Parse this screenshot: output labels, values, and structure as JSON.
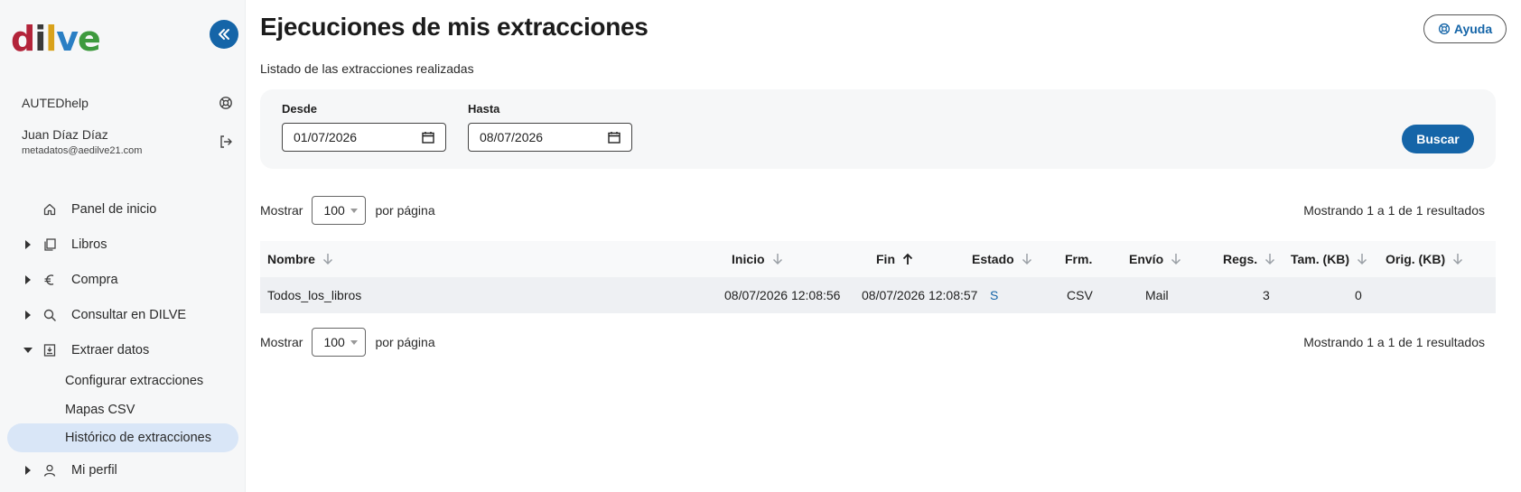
{
  "logo": {
    "letters": [
      "d",
      "i",
      "l",
      "v",
      "e"
    ]
  },
  "sidebar": {
    "org": "AUTEDhelp",
    "user_name": "Juan Díaz Díaz",
    "user_email": "metadatos@aedilve21.com",
    "nav": [
      {
        "label": "Panel de inicio",
        "icon": "home-icon"
      },
      {
        "label": "Libros",
        "icon": "books-icon"
      },
      {
        "label": "Compra",
        "icon": "euro-icon"
      },
      {
        "label": "Consultar en DILVE",
        "icon": "search-icon"
      },
      {
        "label": "Extraer datos",
        "icon": "download-box-icon"
      },
      {
        "label": "Mi perfil",
        "icon": "user-icon"
      }
    ],
    "sub_items": [
      {
        "label": "Configurar extracciones"
      },
      {
        "label": "Mapas CSV"
      },
      {
        "label": "Histórico de extracciones",
        "active": true
      }
    ]
  },
  "header": {
    "title": "Ejecuciones de mis extracciones",
    "subtitle": "Listado de las extracciones realizadas",
    "help_label": "Ayuda"
  },
  "filters": {
    "from_label": "Desde",
    "from_value": "01/07/2026",
    "to_label": "Hasta",
    "to_value": "08/07/2026",
    "search_label": "Buscar"
  },
  "pager": {
    "show_label": "Mostrar",
    "per_page_value": "100",
    "per_page_label": "por página",
    "results_text": "Mostrando 1 a 1 de 1 resultados"
  },
  "table": {
    "columns": [
      "Nombre",
      "Inicio",
      "Fin",
      "Estado",
      "Frm.",
      "Envío",
      "Regs.",
      "Tam. (KB)",
      "Orig. (KB)"
    ],
    "rows": [
      {
        "nombre": "Todos_los_libros",
        "inicio": "08/07/2026 12:08:56",
        "fin": "08/07/2026 12:08:57",
        "estado": "S",
        "frm": "CSV",
        "envio": "Mail",
        "regs": "3",
        "tam": "0",
        "orig": ""
      }
    ]
  },
  "colors": {
    "accent": "#1565a8",
    "active_nav": "#d9e6f7",
    "panel_bg": "#f6f7f8"
  }
}
